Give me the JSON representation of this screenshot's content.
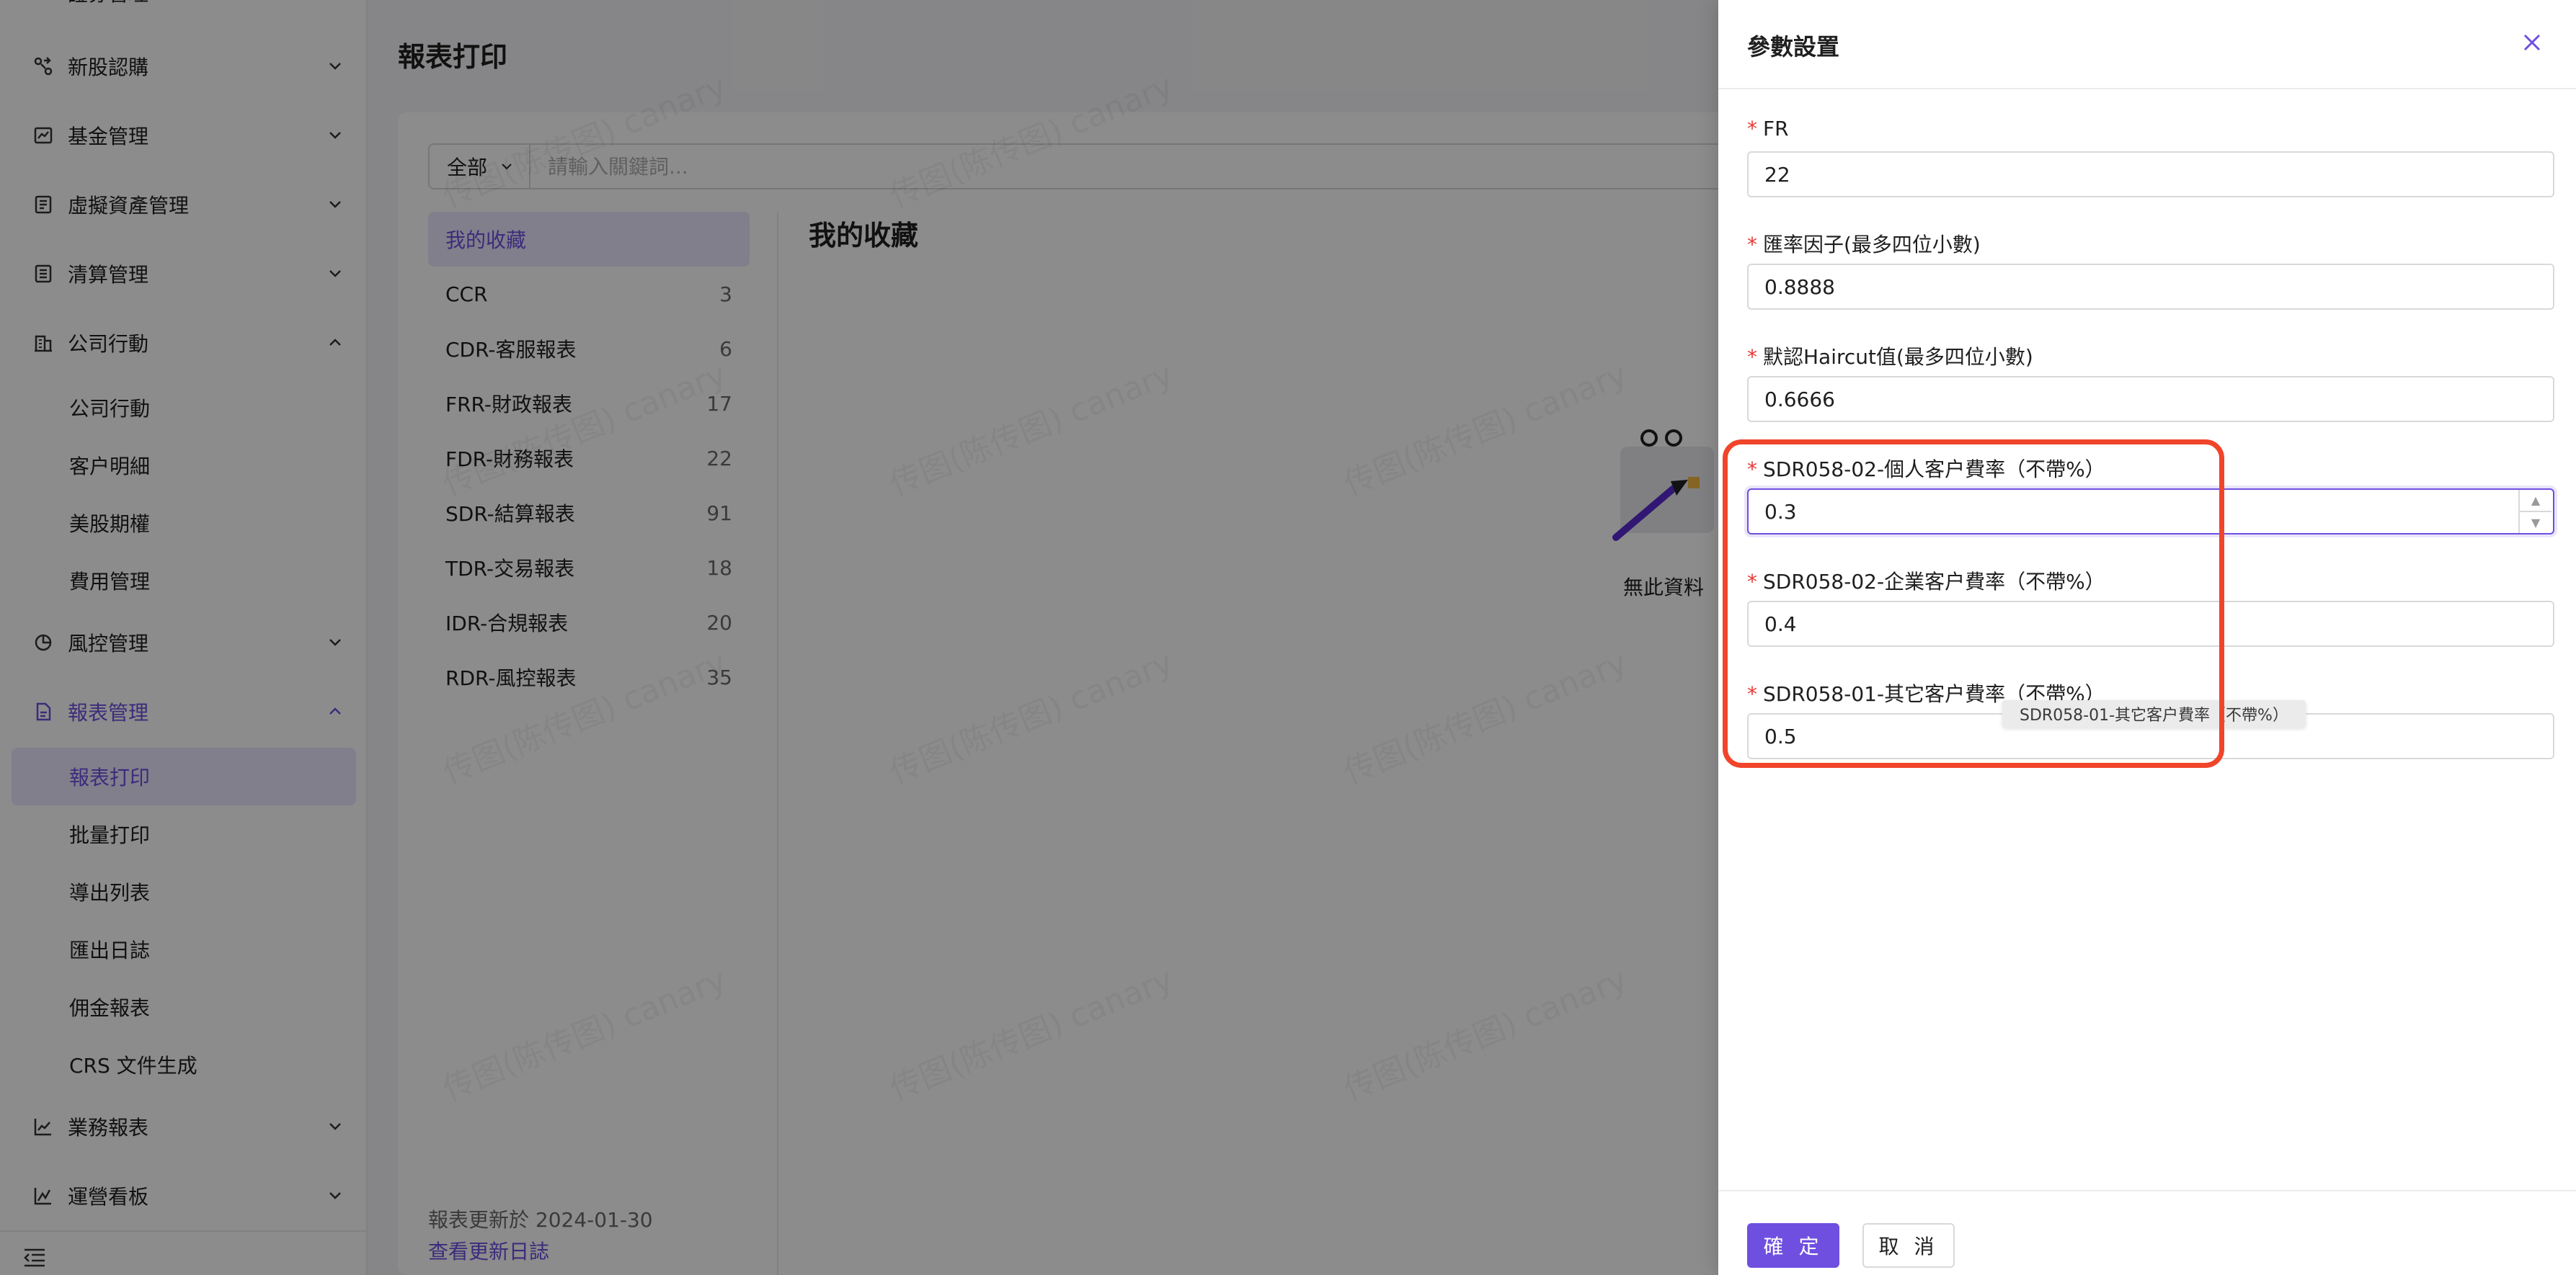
{
  "sidebar": {
    "partial_top_label": "證券管理",
    "items": [
      {
        "label": "新股認購"
      },
      {
        "label": "基金管理"
      },
      {
        "label": "虛擬資產管理"
      },
      {
        "label": "清算管理"
      },
      {
        "label": "公司行動"
      },
      {
        "label": "風控管理"
      },
      {
        "label": "報表管理"
      },
      {
        "label": "業務報表"
      },
      {
        "label": "運營看板"
      }
    ],
    "company_action_sub": [
      {
        "label": "公司行動"
      },
      {
        "label": "客户明細"
      },
      {
        "label": "美股期權"
      },
      {
        "label": "費用管理"
      }
    ],
    "report_sub": [
      {
        "label": "報表打印"
      },
      {
        "label": "批量打印"
      },
      {
        "label": "導出列表"
      },
      {
        "label": "匯出日誌"
      },
      {
        "label": "佣金報表"
      },
      {
        "label": "CRS 文件生成"
      }
    ]
  },
  "main": {
    "page_title": "報表打印",
    "scope_select": "全部",
    "search_placeholder": "請輸入關鍵詞...",
    "categories": [
      {
        "name": "我的收藏",
        "count": ""
      },
      {
        "name": "CCR",
        "count": "3"
      },
      {
        "name": "CDR-客服報表",
        "count": "6"
      },
      {
        "name": "FRR-財政報表",
        "count": "17"
      },
      {
        "name": "FDR-財務報表",
        "count": "22"
      },
      {
        "name": "SDR-結算報表",
        "count": "91"
      },
      {
        "name": "TDR-交易報表",
        "count": "18"
      },
      {
        "name": "IDR-合規報表",
        "count": "20"
      },
      {
        "name": "RDR-風控報表",
        "count": "35"
      }
    ],
    "favorites_title": "我的收藏",
    "empty_text": "無此資料",
    "update_note": "報表更新於 2024-01-30",
    "update_link": "查看更新日誌",
    "watermark": "传图(陈传图) canary"
  },
  "drawer": {
    "title": "參數設置",
    "fields": [
      {
        "label": "FR",
        "value": "22"
      },
      {
        "label": "匯率因子(最多四位小數)",
        "value": "0.8888"
      },
      {
        "label": "默認Haircut值(最多四位小數)",
        "value": "0.6666"
      },
      {
        "label": "SDR058-02-個人客户費率（不帶%）",
        "value": "0.3"
      },
      {
        "label": "SDR058-02-企業客户費率（不帶%）",
        "value": "0.4"
      },
      {
        "label": "SDR058-01-其它客户費率（不帶%）",
        "value": "0.5"
      }
    ],
    "tooltip": "SDR058-01-其它客户費率（不帶%）",
    "confirm_label": "確 定",
    "cancel_label": "取 消"
  },
  "colors": {
    "accent": "#6f4fe0",
    "accent_light": "#ece7fd",
    "required": "#e53935",
    "highlight": "#f0452a"
  }
}
